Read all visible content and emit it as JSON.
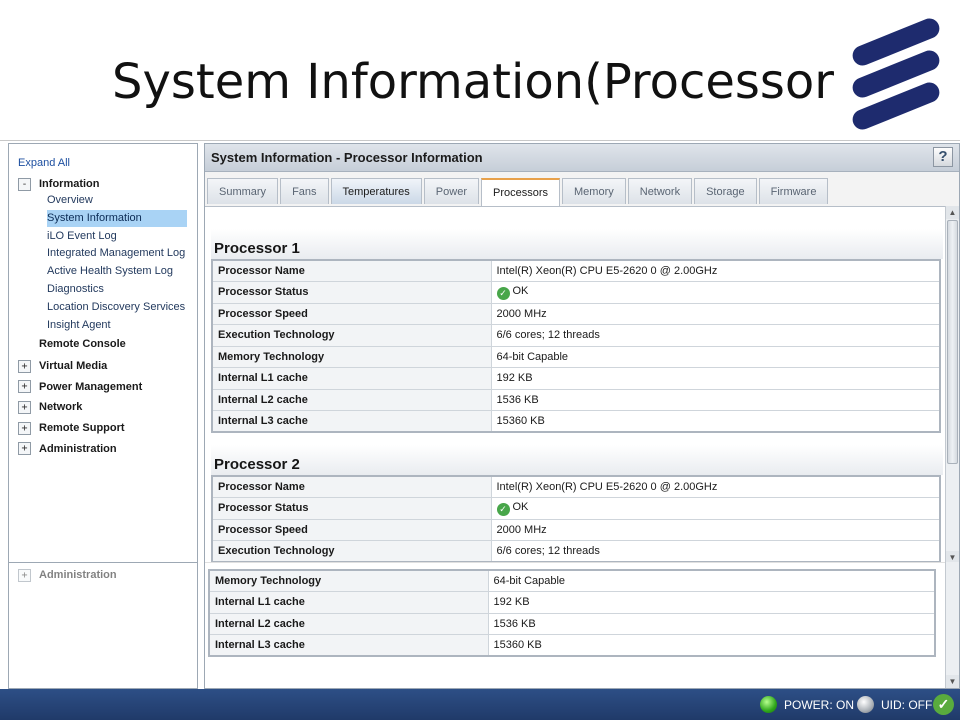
{
  "slide": {
    "title": "System Information(Processor"
  },
  "sidebar": {
    "expand_all": "Expand All",
    "information": {
      "toggle": "-",
      "label": "Information"
    },
    "sub_items": [
      "Overview",
      "System Information",
      "iLO Event Log",
      "Integrated Management Log",
      "Active Health System Log",
      "Diagnostics",
      "Location Discovery Services",
      "Insight Agent"
    ],
    "selected": "System Information",
    "remote_console": "Remote Console",
    "collapsed": [
      {
        "toggle": "+",
        "label": "Virtual Media"
      },
      {
        "toggle": "+",
        "label": "Power Management"
      },
      {
        "toggle": "+",
        "label": "Network"
      },
      {
        "toggle": "+",
        "label": "Remote Support"
      },
      {
        "toggle": "+",
        "label": "Administration"
      }
    ],
    "ghost_label": "Administration"
  },
  "main": {
    "title": "System Information - Processor Information",
    "help": "?",
    "tabs": [
      "Summary",
      "Fans",
      "Temperatures",
      "Power",
      "Processors",
      "Memory",
      "Network",
      "Storage",
      "Firmware"
    ],
    "active_tab": "Processors",
    "processors": [
      {
        "heading": "Processor 1",
        "rows": [
          {
            "k": "Processor Name",
            "v": "Intel(R) Xeon(R) CPU E5-2620 0 @ 2.00GHz"
          },
          {
            "k": "Processor Status",
            "v": "OK"
          },
          {
            "k": "Processor Speed",
            "v": "2000 MHz"
          },
          {
            "k": "Execution Technology",
            "v": "6/6 cores; 12 threads"
          },
          {
            "k": "Memory Technology",
            "v": "64-bit Capable"
          },
          {
            "k": "Internal L1 cache",
            "v": "192 KB"
          },
          {
            "k": "Internal L2 cache",
            "v": "1536 KB"
          },
          {
            "k": "Internal L3 cache",
            "v": "15360 KB"
          }
        ]
      },
      {
        "heading": "Processor 2",
        "rows": [
          {
            "k": "Processor Name",
            "v": "Intel(R) Xeon(R) CPU E5-2620 0 @ 2.00GHz"
          },
          {
            "k": "Processor Status",
            "v": "OK"
          },
          {
            "k": "Processor Speed",
            "v": "2000 MHz"
          },
          {
            "k": "Execution Technology",
            "v": "6/6 cores; 12 threads"
          }
        ]
      }
    ],
    "ghost_rows": [
      {
        "k": "Memory Technology",
        "v": "64-bit Capable"
      },
      {
        "k": "Internal L1 cache",
        "v": "192 KB"
      },
      {
        "k": "Internal L2 cache",
        "v": "1536 KB"
      },
      {
        "k": "Internal L3 cache",
        "v": "15360 KB"
      }
    ]
  },
  "status_bar": {
    "power": "POWER: ON",
    "uid": "UID: OFF",
    "power_color": "#2ea61a",
    "uid_color": "#aab0b6"
  }
}
